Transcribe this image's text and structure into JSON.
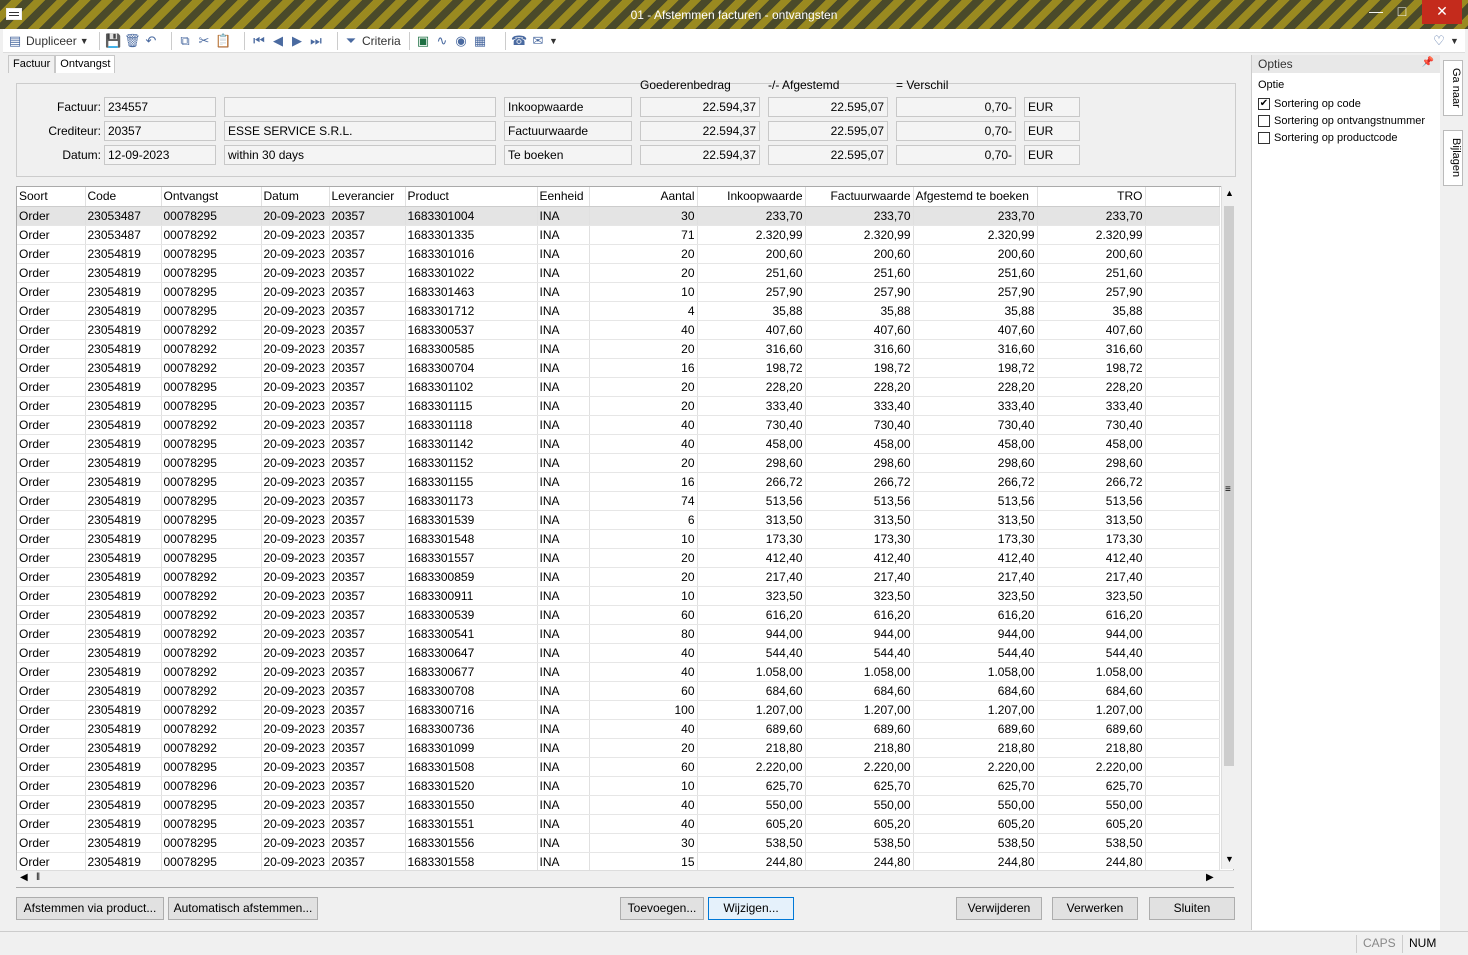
{
  "window": {
    "title": "01 - Afstemmen facturen - ontvangsten"
  },
  "toolbar": {
    "duplicate": "Dupliceer",
    "criteria": "Criteria"
  },
  "tabs": [
    "Factuur",
    "Ontvangst"
  ],
  "header": {
    "factuur_label": "Factuur:",
    "factuur": "234557",
    "crediteur_label": "Crediteur:",
    "crediteur": "20357",
    "crediteur_name": "ESSE SERVICE S.R.L.",
    "datum_label": "Datum:",
    "datum": "12-09-2023",
    "terms": "within 30 days",
    "col_goederen": "Goederenbedrag",
    "col_afgestemd": "-/- Afgestemd",
    "col_verschil": "= Verschil",
    "rows": [
      {
        "label": "Inkoopwaarde",
        "goederen": "22.594,37",
        "afgestemd": "22.595,07",
        "verschil": "0,70-",
        "cur": "EUR"
      },
      {
        "label": "Factuurwaarde",
        "goederen": "22.594,37",
        "afgestemd": "22.595,07",
        "verschil": "0,70-",
        "cur": "EUR"
      },
      {
        "label": "Te boeken",
        "goederen": "22.594,37",
        "afgestemd": "22.595,07",
        "verschil": "0,70-",
        "cur": "EUR"
      }
    ]
  },
  "grid": {
    "columns": [
      "Soort",
      "Code",
      "Ontvangst",
      "Datum",
      "Leverancier",
      "Product",
      "Eenheid",
      "Aantal",
      "Inkoopwaarde",
      "Factuurwaarde",
      "Afgestemd te boeken",
      "TRO"
    ],
    "rows": [
      [
        "Order",
        "23053487",
        "00078295",
        "20-09-2023",
        "20357",
        "1683301004",
        "INA",
        "30",
        "233,70",
        "233,70",
        "233,70",
        "233,70"
      ],
      [
        "Order",
        "23053487",
        "00078292",
        "20-09-2023",
        "20357",
        "1683301335",
        "INA",
        "71",
        "2.320,99",
        "2.320,99",
        "2.320,99",
        "2.320,99"
      ],
      [
        "Order",
        "23054819",
        "00078295",
        "20-09-2023",
        "20357",
        "1683301016",
        "INA",
        "20",
        "200,60",
        "200,60",
        "200,60",
        "200,60"
      ],
      [
        "Order",
        "23054819",
        "00078295",
        "20-09-2023",
        "20357",
        "1683301022",
        "INA",
        "20",
        "251,60",
        "251,60",
        "251,60",
        "251,60"
      ],
      [
        "Order",
        "23054819",
        "00078295",
        "20-09-2023",
        "20357",
        "1683301463",
        "INA",
        "10",
        "257,90",
        "257,90",
        "257,90",
        "257,90"
      ],
      [
        "Order",
        "23054819",
        "00078295",
        "20-09-2023",
        "20357",
        "1683301712",
        "INA",
        "4",
        "35,88",
        "35,88",
        "35,88",
        "35,88"
      ],
      [
        "Order",
        "23054819",
        "00078292",
        "20-09-2023",
        "20357",
        "1683300537",
        "INA",
        "40",
        "407,60",
        "407,60",
        "407,60",
        "407,60"
      ],
      [
        "Order",
        "23054819",
        "00078292",
        "20-09-2023",
        "20357",
        "1683300585",
        "INA",
        "20",
        "316,60",
        "316,60",
        "316,60",
        "316,60"
      ],
      [
        "Order",
        "23054819",
        "00078292",
        "20-09-2023",
        "20357",
        "1683300704",
        "INA",
        "16",
        "198,72",
        "198,72",
        "198,72",
        "198,72"
      ],
      [
        "Order",
        "23054819",
        "00078295",
        "20-09-2023",
        "20357",
        "1683301102",
        "INA",
        "20",
        "228,20",
        "228,20",
        "228,20",
        "228,20"
      ],
      [
        "Order",
        "23054819",
        "00078295",
        "20-09-2023",
        "20357",
        "1683301115",
        "INA",
        "20",
        "333,40",
        "333,40",
        "333,40",
        "333,40"
      ],
      [
        "Order",
        "23054819",
        "00078292",
        "20-09-2023",
        "20357",
        "1683301118",
        "INA",
        "40",
        "730,40",
        "730,40",
        "730,40",
        "730,40"
      ],
      [
        "Order",
        "23054819",
        "00078295",
        "20-09-2023",
        "20357",
        "1683301142",
        "INA",
        "40",
        "458,00",
        "458,00",
        "458,00",
        "458,00"
      ],
      [
        "Order",
        "23054819",
        "00078295",
        "20-09-2023",
        "20357",
        "1683301152",
        "INA",
        "20",
        "298,60",
        "298,60",
        "298,60",
        "298,60"
      ],
      [
        "Order",
        "23054819",
        "00078295",
        "20-09-2023",
        "20357",
        "1683301155",
        "INA",
        "16",
        "266,72",
        "266,72",
        "266,72",
        "266,72"
      ],
      [
        "Order",
        "23054819",
        "00078295",
        "20-09-2023",
        "20357",
        "1683301173",
        "INA",
        "74",
        "513,56",
        "513,56",
        "513,56",
        "513,56"
      ],
      [
        "Order",
        "23054819",
        "00078295",
        "20-09-2023",
        "20357",
        "1683301539",
        "INA",
        "6",
        "313,50",
        "313,50",
        "313,50",
        "313,50"
      ],
      [
        "Order",
        "23054819",
        "00078295",
        "20-09-2023",
        "20357",
        "1683301548",
        "INA",
        "10",
        "173,30",
        "173,30",
        "173,30",
        "173,30"
      ],
      [
        "Order",
        "23054819",
        "00078295",
        "20-09-2023",
        "20357",
        "1683301557",
        "INA",
        "20",
        "412,40",
        "412,40",
        "412,40",
        "412,40"
      ],
      [
        "Order",
        "23054819",
        "00078292",
        "20-09-2023",
        "20357",
        "1683300859",
        "INA",
        "20",
        "217,40",
        "217,40",
        "217,40",
        "217,40"
      ],
      [
        "Order",
        "23054819",
        "00078292",
        "20-09-2023",
        "20357",
        "1683300911",
        "INA",
        "10",
        "323,50",
        "323,50",
        "323,50",
        "323,50"
      ],
      [
        "Order",
        "23054819",
        "00078292",
        "20-09-2023",
        "20357",
        "1683300539",
        "INA",
        "60",
        "616,20",
        "616,20",
        "616,20",
        "616,20"
      ],
      [
        "Order",
        "23054819",
        "00078292",
        "20-09-2023",
        "20357",
        "1683300541",
        "INA",
        "80",
        "944,00",
        "944,00",
        "944,00",
        "944,00"
      ],
      [
        "Order",
        "23054819",
        "00078292",
        "20-09-2023",
        "20357",
        "1683300647",
        "INA",
        "40",
        "544,40",
        "544,40",
        "544,40",
        "544,40"
      ],
      [
        "Order",
        "23054819",
        "00078292",
        "20-09-2023",
        "20357",
        "1683300677",
        "INA",
        "40",
        "1.058,00",
        "1.058,00",
        "1.058,00",
        "1.058,00"
      ],
      [
        "Order",
        "23054819",
        "00078292",
        "20-09-2023",
        "20357",
        "1683300708",
        "INA",
        "60",
        "684,60",
        "684,60",
        "684,60",
        "684,60"
      ],
      [
        "Order",
        "23054819",
        "00078292",
        "20-09-2023",
        "20357",
        "1683300716",
        "INA",
        "100",
        "1.207,00",
        "1.207,00",
        "1.207,00",
        "1.207,00"
      ],
      [
        "Order",
        "23054819",
        "00078292",
        "20-09-2023",
        "20357",
        "1683300736",
        "INA",
        "40",
        "689,60",
        "689,60",
        "689,60",
        "689,60"
      ],
      [
        "Order",
        "23054819",
        "00078292",
        "20-09-2023",
        "20357",
        "1683301099",
        "INA",
        "20",
        "218,80",
        "218,80",
        "218,80",
        "218,80"
      ],
      [
        "Order",
        "23054819",
        "00078295",
        "20-09-2023",
        "20357",
        "1683301508",
        "INA",
        "60",
        "2.220,00",
        "2.220,00",
        "2.220,00",
        "2.220,00"
      ],
      [
        "Order",
        "23054819",
        "00078296",
        "20-09-2023",
        "20357",
        "1683301520",
        "INA",
        "10",
        "625,70",
        "625,70",
        "625,70",
        "625,70"
      ],
      [
        "Order",
        "23054819",
        "00078295",
        "20-09-2023",
        "20357",
        "1683301550",
        "INA",
        "40",
        "550,00",
        "550,00",
        "550,00",
        "550,00"
      ],
      [
        "Order",
        "23054819",
        "00078295",
        "20-09-2023",
        "20357",
        "1683301551",
        "INA",
        "40",
        "605,20",
        "605,20",
        "605,20",
        "605,20"
      ],
      [
        "Order",
        "23054819",
        "00078295",
        "20-09-2023",
        "20357",
        "1683301556",
        "INA",
        "30",
        "538,50",
        "538,50",
        "538,50",
        "538,50"
      ],
      [
        "Order",
        "23054819",
        "00078295",
        "20-09-2023",
        "20357",
        "1683301558",
        "INA",
        "15",
        "244,80",
        "244,80",
        "244,80",
        "244,80"
      ]
    ]
  },
  "buttons": {
    "via_product": "Afstemmen via product...",
    "auto": "Automatisch afstemmen...",
    "toevoegen": "Toevoegen...",
    "wijzigen": "Wijzigen...",
    "verwijderen": "Verwijderen",
    "verwerken": "Verwerken",
    "sluiten": "Sluiten"
  },
  "opties": {
    "title": "Opties",
    "col": "Optie",
    "items": [
      {
        "label": "Sortering op code",
        "checked": true
      },
      {
        "label": "Sortering op ontvangstnummer",
        "checked": false
      },
      {
        "label": "Sortering op productcode",
        "checked": false
      }
    ]
  },
  "side_tabs": [
    "Ga naar",
    "Bijlagen"
  ],
  "status": {
    "caps": "CAPS",
    "num": "NUM"
  }
}
